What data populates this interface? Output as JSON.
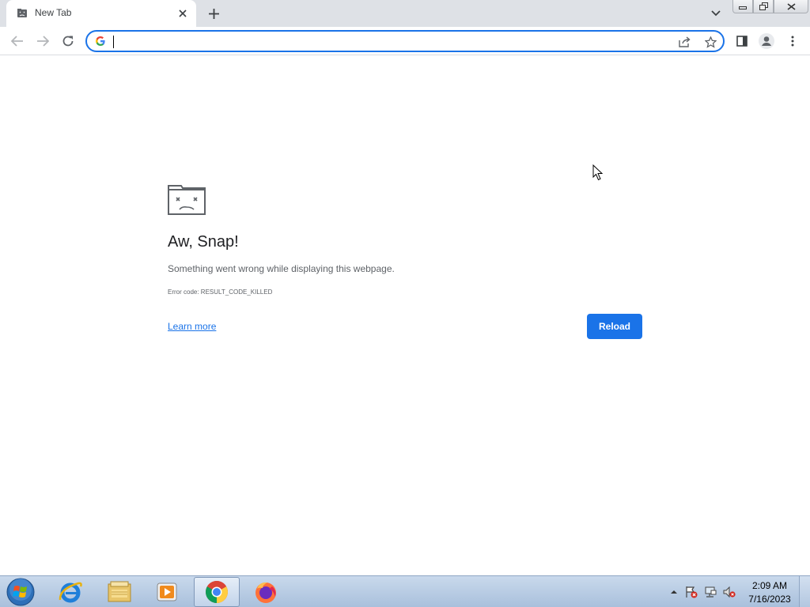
{
  "tab": {
    "title": "New Tab",
    "favicon": "sad-tab-icon"
  },
  "omnibox": {
    "value": "",
    "placeholder": ""
  },
  "error": {
    "title": "Aw, Snap!",
    "description": "Something went wrong while displaying this webpage.",
    "code": "Error code: RESULT_CODE_KILLED",
    "learn_more": "Learn more",
    "reload": "Reload"
  },
  "taskbar": {
    "apps": [
      "internet-explorer-icon",
      "file-explorer-icon",
      "media-player-icon",
      "chrome-icon",
      "firefox-icon"
    ],
    "time": "2:09 AM",
    "date": "7/16/2023"
  },
  "colors": {
    "accent": "#1a73e8",
    "tabstrip": "#dee1e6",
    "taskbar": "#b9cde6"
  }
}
